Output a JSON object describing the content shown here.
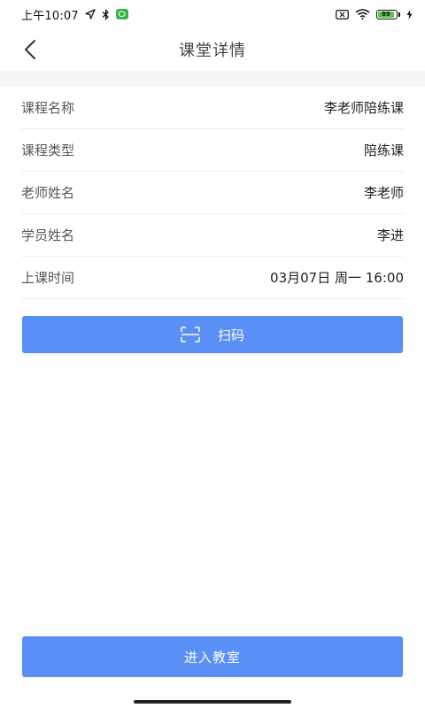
{
  "status_bar": {
    "time": "上午10:07",
    "battery_level": "89",
    "icons": [
      "location-icon",
      "bluetooth-icon",
      "wechat-icon",
      "sim-disabled-icon",
      "wifi-icon",
      "battery-icon",
      "charging-icon"
    ]
  },
  "header": {
    "title": "课堂详情",
    "back_icon": "chevron-left-icon"
  },
  "details": {
    "rows": [
      {
        "label": "课程名称",
        "value": "李老师陪练课"
      },
      {
        "label": "课程类型",
        "value": "陪练课"
      },
      {
        "label": "老师姓名",
        "value": "李老师"
      },
      {
        "label": "学员姓名",
        "value": "李进"
      },
      {
        "label": "上课时间",
        "value": "03月07日 周一 16:00"
      }
    ]
  },
  "actions": {
    "scan_label": "扫码",
    "scan_icon": "scan-icon",
    "enter_label": "进入教室"
  },
  "colors": {
    "primary": "#5a8ff5",
    "battery": "#5cc84a",
    "wechat": "#3cb34a"
  }
}
